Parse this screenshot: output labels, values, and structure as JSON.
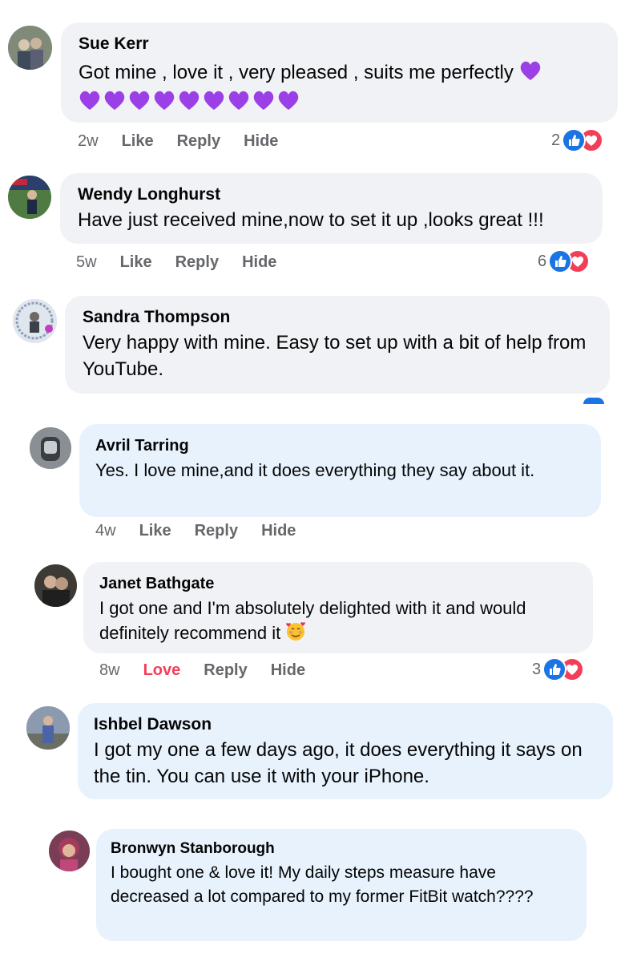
{
  "colors": {
    "bubble_grey": "#f0f2f5",
    "bubble_blue": "#e7f2fd",
    "action_grey": "#65676b",
    "like_blue": "#1b74e4",
    "love_red": "#f33e58",
    "purple_heart": "#9b3fe6"
  },
  "comments": [
    {
      "author": "Sue Kerr",
      "text": "Got mine , love it , very pleased , suits me perfectly",
      "emoji": "purple-heart",
      "emoji_row_count": 9,
      "time": "2w",
      "like_label": "Like",
      "reply_label": "Reply",
      "hide_label": "Hide",
      "reaction_count": "2",
      "reactions": [
        "like-icon",
        "heart-icon"
      ]
    },
    {
      "author": "Wendy Longhurst",
      "text": "Have just received mine,now to set it up ,looks great !!!",
      "time": "5w",
      "like_label": "Like",
      "reply_label": "Reply",
      "hide_label": "Hide",
      "reaction_count": "6",
      "reactions": [
        "like-icon",
        "heart-icon"
      ]
    },
    {
      "author": "Sandra Thompson",
      "text": "Very happy with mine. Easy to set up with a bit of help from YouTube."
    },
    {
      "author": "Avril Tarring",
      "text": "Yes. I love mine,and it does everything they say about it.",
      "time": "4w",
      "like_label": "Like",
      "reply_label": "Reply",
      "hide_label": "Hide"
    },
    {
      "author": "Janet Bathgate",
      "text": "I got one and I'm absolutely delighted with it and would definitely recommend it",
      "emoji": "smiling-face-with-hearts",
      "time": "8w",
      "like_label": "Love",
      "reply_label": "Reply",
      "hide_label": "Hide",
      "reaction_count": "3",
      "reactions": [
        "like-icon",
        "heart-icon"
      ]
    },
    {
      "author": "Ishbel Dawson",
      "text": "I got my one a few days ago, it does everything it says on the tin. You can use it with your iPhone."
    },
    {
      "author": "Bronwyn Stanborough",
      "text": "I bought one & love it! My daily steps measure have decreased a lot compared to my former FitBit watch????"
    }
  ]
}
